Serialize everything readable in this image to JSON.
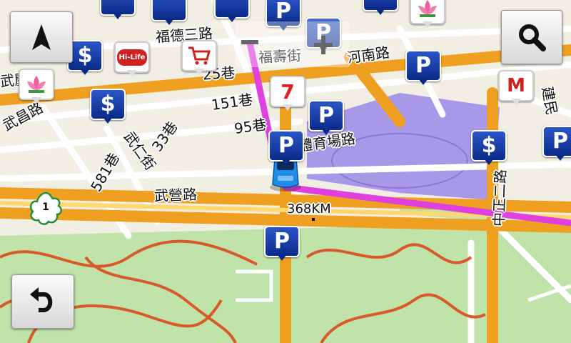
{
  "map": {
    "street_labels": [
      "福德三路",
      "福壽街",
      "河南路",
      "武慶路",
      "武昌路",
      "151巷",
      "25巷",
      "95巷",
      "33巷",
      "體育場路",
      "武仁街",
      "581巷",
      "武營路",
      "中正二路",
      "建民"
    ],
    "route_distance": "368KM",
    "road_shield": "1",
    "colors": {
      "route": "#e040e0",
      "main_road": "#f0a020",
      "park": "#a8d890",
      "stadium": "#a898e8",
      "trail": "#d85a2a"
    }
  },
  "pois": [
    {
      "type": "parking",
      "glyph": "P"
    },
    {
      "type": "bank",
      "glyph": "$"
    },
    {
      "type": "convenience-store",
      "glyph": "7"
    },
    {
      "type": "hi-life-store",
      "glyph": "Hi-Life"
    },
    {
      "type": "shopping-cart",
      "glyph": "cart"
    },
    {
      "type": "temple",
      "glyph": "lotus"
    },
    {
      "type": "mos-burger",
      "glyph": "M"
    }
  ],
  "controls": {
    "compass_icon": "north-arrow-icon",
    "search_icon": "magnifier-icon",
    "back_icon": "undo-arrow-icon",
    "zoom_in_icon": "plus-icon",
    "zoom_out_icon": "minus-icon"
  }
}
